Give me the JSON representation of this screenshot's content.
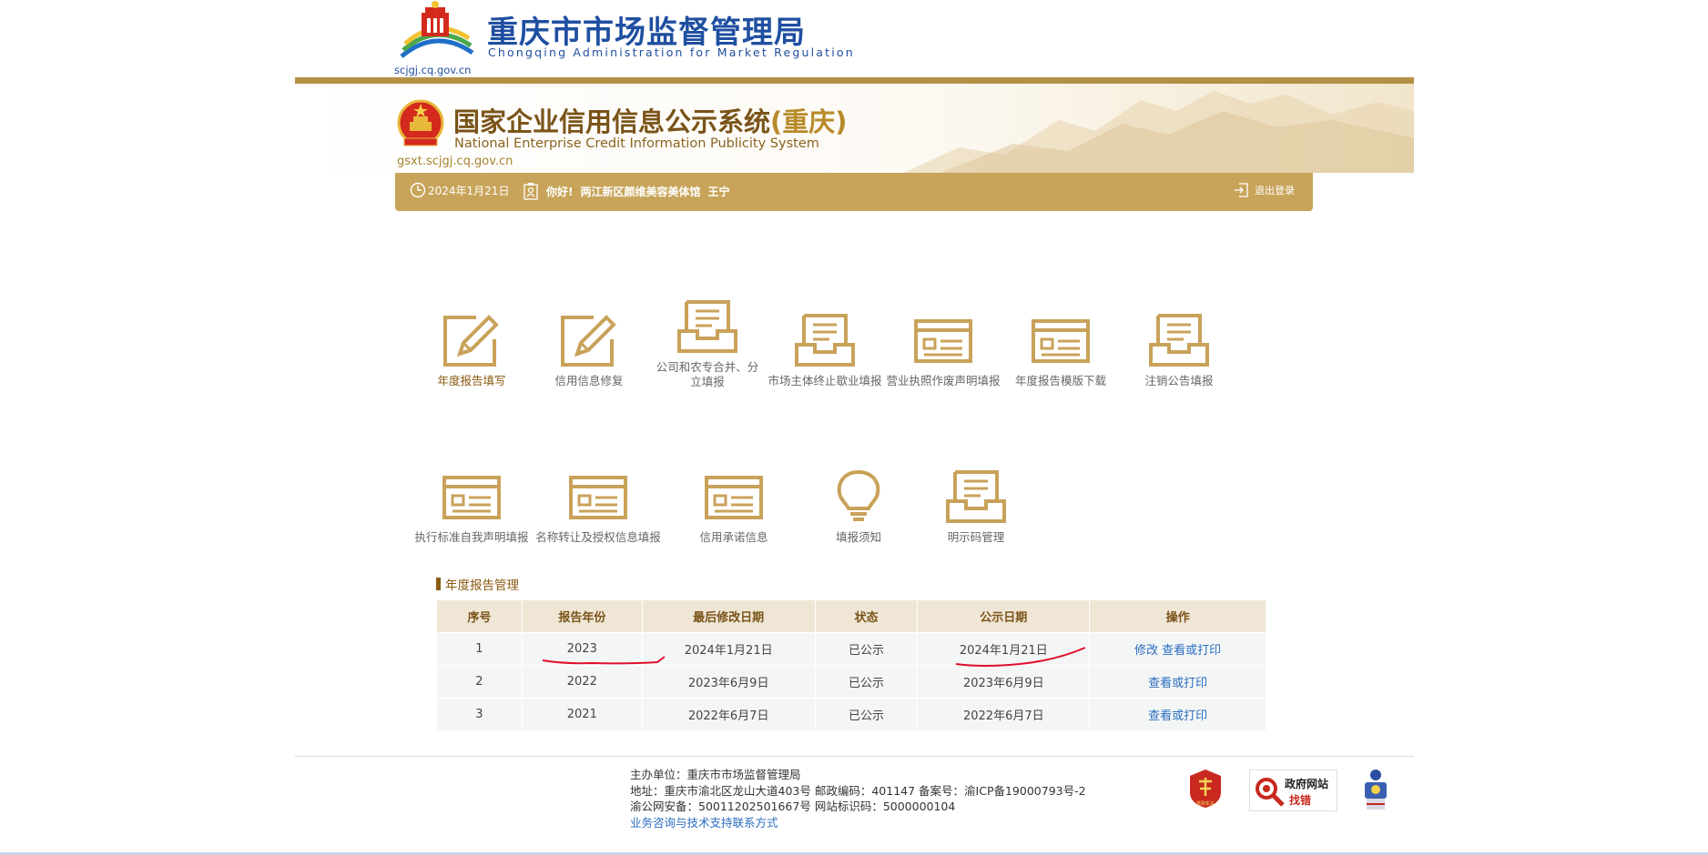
{
  "header1": {
    "title": "重庆市市场监督管理局",
    "subtitle": "Chongqing  Administration for Market Regulation",
    "domain": "scjgj.cq.gov.cn"
  },
  "header2": {
    "title": "国家企业信用信息公示系统",
    "title_region": "(重庆)",
    "subtitle": "National Enterprise Credit Information Publicity System",
    "domain": "gsxt.scjgj.cq.gov.cn"
  },
  "infobar": {
    "date": "2024年1月21日",
    "greeting": "你好!",
    "company": "两江新区颜维美容美体馆",
    "username": "王宁",
    "logout": "退出登录"
  },
  "tiles": [
    {
      "label": "年度报告填写",
      "icon": "edit-icon"
    },
    {
      "label": "信用信息修复",
      "icon": "edit-icon"
    },
    {
      "label": "公司和农专合并、分立填报",
      "icon": "inbox-icon"
    },
    {
      "label": "市场主体终止歇业填报",
      "icon": "inbox-icon"
    },
    {
      "label": "营业执照作废声明填报",
      "icon": "card-icon"
    },
    {
      "label": "年度报告模版下载",
      "icon": "card-icon"
    },
    {
      "label": "注销公告填报",
      "icon": "inbox-icon"
    },
    {
      "label": "执行标准自我声明填报",
      "icon": "card-icon"
    },
    {
      "label": "名称转让及授权信息填报",
      "icon": "card-icon"
    },
    {
      "label": "信用承诺信息",
      "icon": "card-icon"
    },
    {
      "label": "填报须知",
      "icon": "lightbulb-icon"
    },
    {
      "label": "明示码管理",
      "icon": "inbox-icon"
    }
  ],
  "section": {
    "title": "年度报告管理"
  },
  "table": {
    "headers": [
      "序号",
      "报告年份",
      "最后修改日期",
      "状态",
      "公示日期",
      "操作"
    ],
    "rows": [
      {
        "no": "1",
        "year": "2023",
        "modified": "2024年1月21日",
        "status": "已公示",
        "published": "2024年1月21日",
        "action_edit": "修改",
        "action_view": "查看或打印"
      },
      {
        "no": "2",
        "year": "2022",
        "modified": "2023年6月9日",
        "status": "已公示",
        "published": "2023年6月9日",
        "action_edit": "",
        "action_view": "查看或打印"
      },
      {
        "no": "3",
        "year": "2021",
        "modified": "2022年6月7日",
        "status": "已公示",
        "published": "2022年6月7日",
        "action_edit": "",
        "action_view": "查看或打印"
      }
    ]
  },
  "footer": {
    "sponsor": "主办单位：重庆市市场监督管理局",
    "address": "地址：重庆市渝北区龙山大道403号 邮政编码：401147 备案号：渝ICP备19000793号-2",
    "security": "渝公网安备：50011202501667号 网站标识码：5000000104",
    "contact_link": "业务咨询与技术支持联系方式",
    "badge_gov_line1": "政府网站",
    "badge_gov_line2": "找错",
    "badge_party": "党政机关"
  },
  "colors": {
    "gold": "#c8a45a",
    "brown": "#7a5418",
    "blue": "#1f4fa0",
    "link": "#2a6cc0",
    "annotation": "#e0102a"
  }
}
